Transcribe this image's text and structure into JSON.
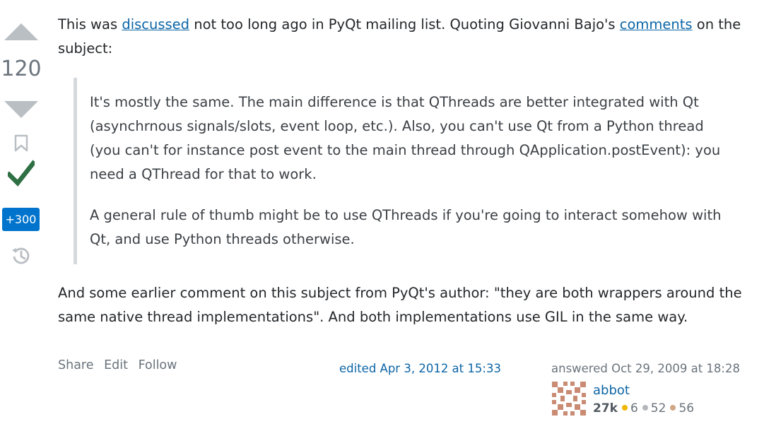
{
  "vote": {
    "count": "120"
  },
  "bounty": {
    "label": "+300"
  },
  "answer": {
    "para1": {
      "t1": "This was ",
      "link1": "discussed",
      "t2": " not too long ago in PyQt mailing list. Quoting Giovanni Bajo's ",
      "link2": "comments",
      "t3": " on the subject:"
    },
    "quote1": "It's mostly the same. The main difference is that QThreads are better integrated with Qt (asynchrnous signals/slots, event loop, etc.). Also, you can't use Qt from a Python thread (you can't for instance post event to the main thread through QApplication.postEvent): you need a QThread for that to work.",
    "quote2": "A general rule of thumb might be to use QThreads if you're going to interact somehow with Qt, and use Python threads otherwise.",
    "para2": "And some earlier comment on this subject from PyQt's author: \"they are both wrappers around the same native thread implementations\". And both implementations use GIL in the same way."
  },
  "actions": {
    "share": "Share",
    "edit": "Edit",
    "follow": "Follow"
  },
  "edited": "edited Apr 3, 2012 at 15:33",
  "answered": "answered Oct 29, 2009 at 18:28",
  "user": {
    "name": "abbot",
    "reputation": "27k",
    "gold": "6",
    "silver": "52",
    "bronze": "56"
  },
  "colors": {
    "gold": "#f1b600",
    "silver": "#b4b8bc",
    "bronze": "#d1a684",
    "accepted": "#2f6f44",
    "link": "#0c65a6"
  },
  "icons": {
    "up": "vote-up-arrow",
    "down": "vote-down-arrow",
    "bookmark": "bookmark-icon",
    "accepted": "check-icon",
    "history": "history-icon"
  }
}
